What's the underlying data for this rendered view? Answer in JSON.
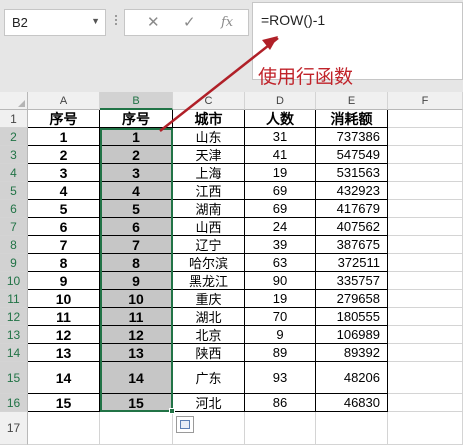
{
  "namebox": {
    "value": "B2"
  },
  "formula_bar": {
    "cancel": "✕",
    "enter": "✓",
    "fx": "fx",
    "value": "=ROW()-1"
  },
  "annotation": {
    "text": "使用行函数",
    "color": "#c0232a"
  },
  "accent": "#217346",
  "columns": [
    "A",
    "B",
    "C",
    "D",
    "E",
    "F"
  ],
  "rows": [
    "1",
    "2",
    "3",
    "4",
    "5",
    "6",
    "7",
    "8",
    "9",
    "10",
    "11",
    "12",
    "13",
    "14",
    "15",
    "16",
    "17"
  ],
  "header_row": [
    "序号",
    "序号",
    "城市",
    "人数",
    "消耗额"
  ],
  "data": [
    [
      "1",
      "1",
      "山东",
      "31",
      "737386"
    ],
    [
      "2",
      "2",
      "天津",
      "41",
      "547549"
    ],
    [
      "3",
      "3",
      "上海",
      "19",
      "531563"
    ],
    [
      "4",
      "4",
      "江西",
      "69",
      "432923"
    ],
    [
      "5",
      "5",
      "湖南",
      "69",
      "417679"
    ],
    [
      "6",
      "6",
      "山西",
      "24",
      "407562"
    ],
    [
      "7",
      "7",
      "辽宁",
      "39",
      "387675"
    ],
    [
      "8",
      "8",
      "哈尔滨",
      "63",
      "372511"
    ],
    [
      "9",
      "9",
      "黑龙江",
      "90",
      "335757"
    ],
    [
      "10",
      "10",
      "重庆",
      "19",
      "279658"
    ],
    [
      "11",
      "11",
      "湖北",
      "70",
      "180555"
    ],
    [
      "12",
      "12",
      "北京",
      "9",
      "106989"
    ],
    [
      "13",
      "13",
      "陕西",
      "89",
      "89392"
    ],
    [
      "14",
      "14",
      "广东",
      "93",
      "48206"
    ],
    [
      "15",
      "15",
      "河北",
      "86",
      "46830"
    ]
  ]
}
